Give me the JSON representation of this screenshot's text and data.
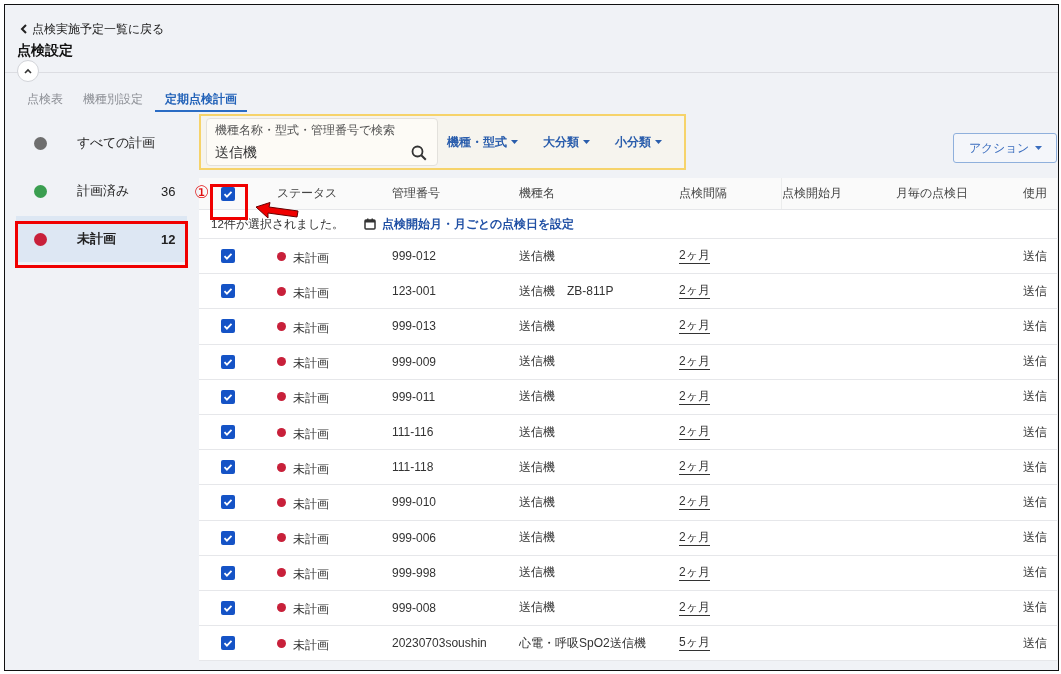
{
  "header": {
    "back_link": "点検実施予定一覧に戻る",
    "title": "点検設定"
  },
  "tabs": [
    {
      "label": "点検表",
      "selected": false
    },
    {
      "label": "機種別設定",
      "selected": false
    },
    {
      "label": "定期点検計画",
      "selected": true
    }
  ],
  "sidebar": {
    "items": [
      {
        "label": "すべての計画",
        "color": "#6e6e6e",
        "selected": false
      },
      {
        "label": "計画済み",
        "count": "36",
        "color": "#3a9e50",
        "selected": false
      },
      {
        "label": "未計画",
        "count": "12",
        "color": "#c8203a",
        "selected": true
      }
    ]
  },
  "filters": {
    "search": {
      "placeholder": "機種名称・型式・管理番号で検索",
      "value": "送信機"
    },
    "dropdowns": [
      "機種・型式",
      "大分類",
      "小分類"
    ]
  },
  "action_button": "アクション",
  "callout": {
    "label": "①"
  },
  "table": {
    "select_all": {
      "checked": true
    },
    "columns": [
      "ステータス",
      "管理番号",
      "機種名",
      "点検間隔",
      "点検開始月",
      "月毎の点検日",
      "使用"
    ],
    "selection_bar": {
      "message": "12件が選択されました。",
      "link": "点検開始月・月ごとの点検日を設定"
    },
    "rows": [
      {
        "checked": true,
        "status": "未計画",
        "color": "#c8203a",
        "id": "999-012",
        "model": "送信機",
        "interval": "2ヶ月",
        "column_7": "送信"
      },
      {
        "checked": true,
        "status": "未計画",
        "color": "#c8203a",
        "id": "123-001",
        "model": "送信機　ZB-811P",
        "interval": "2ヶ月",
        "column_7": "送信"
      },
      {
        "checked": true,
        "status": "未計画",
        "color": "#c8203a",
        "id": "999-013",
        "model": "送信機",
        "interval": "2ヶ月",
        "column_7": "送信"
      },
      {
        "checked": true,
        "status": "未計画",
        "color": "#c8203a",
        "id": "999-009",
        "model": "送信機",
        "interval": "2ヶ月",
        "column_7": "送信"
      },
      {
        "checked": true,
        "status": "未計画",
        "color": "#c8203a",
        "id": "999-011",
        "model": "送信機",
        "interval": "2ヶ月",
        "column_7": "送信"
      },
      {
        "checked": true,
        "status": "未計画",
        "color": "#c8203a",
        "id": "111-116",
        "model": "送信機",
        "interval": "2ヶ月",
        "column_7": "送信"
      },
      {
        "checked": true,
        "status": "未計画",
        "color": "#c8203a",
        "id": "111-118",
        "model": "送信機",
        "interval": "2ヶ月",
        "column_7": "送信"
      },
      {
        "checked": true,
        "status": "未計画",
        "color": "#c8203a",
        "id": "999-010",
        "model": "送信機",
        "interval": "2ヶ月",
        "column_7": "送信"
      },
      {
        "checked": true,
        "status": "未計画",
        "color": "#c8203a",
        "id": "999-006",
        "model": "送信機",
        "interval": "2ヶ月",
        "column_7": "送信"
      },
      {
        "checked": true,
        "status": "未計画",
        "color": "#c8203a",
        "id": "999-998",
        "model": "送信機",
        "interval": "2ヶ月",
        "column_7": "送信"
      },
      {
        "checked": true,
        "status": "未計画",
        "color": "#c8203a",
        "id": "999-008",
        "model": "送信機",
        "interval": "2ヶ月",
        "column_7": "送信"
      },
      {
        "checked": true,
        "status": "未計画",
        "color": "#c8203a",
        "id": "20230703soushin",
        "model": "心電・呼吸SpO2送信機",
        "interval": "5ヶ月",
        "column_7": "送信"
      }
    ]
  }
}
